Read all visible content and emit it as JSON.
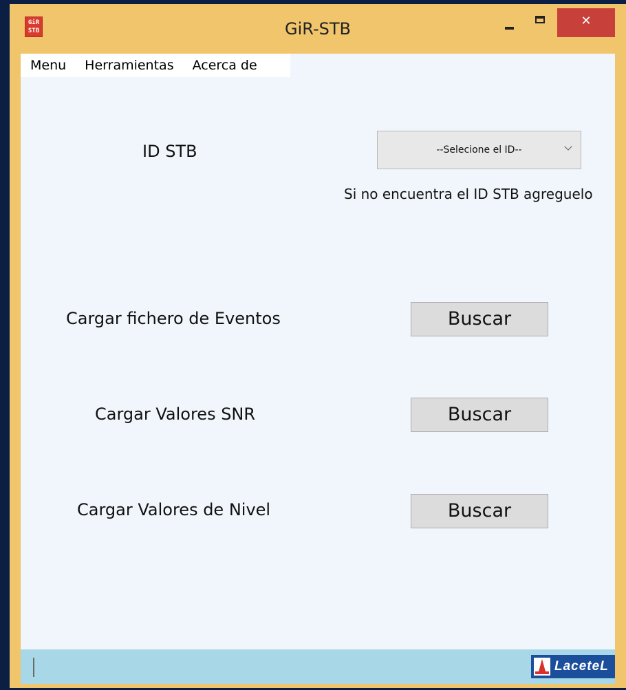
{
  "window": {
    "title": "GiR-STB",
    "icon_text": "GiR\nSTB",
    "close_glyph": "✕",
    "accent_color": "#f0c56b"
  },
  "menu": {
    "items": [
      "Menu",
      "Herramientas",
      "Acerca de"
    ]
  },
  "form": {
    "id_label": "ID STB",
    "id_select_value": "--Selecione el ID--",
    "id_hint": "Si no encuentra el ID STB agreguelo",
    "rows": [
      {
        "label": "Cargar fichero de Eventos",
        "button": "Buscar"
      },
      {
        "label": "Cargar Valores SNR",
        "button": "Buscar"
      },
      {
        "label": "Cargar Valores de Nivel",
        "button": "Buscar"
      }
    ]
  },
  "statusbar": {
    "logo_text": "LaceteL"
  }
}
